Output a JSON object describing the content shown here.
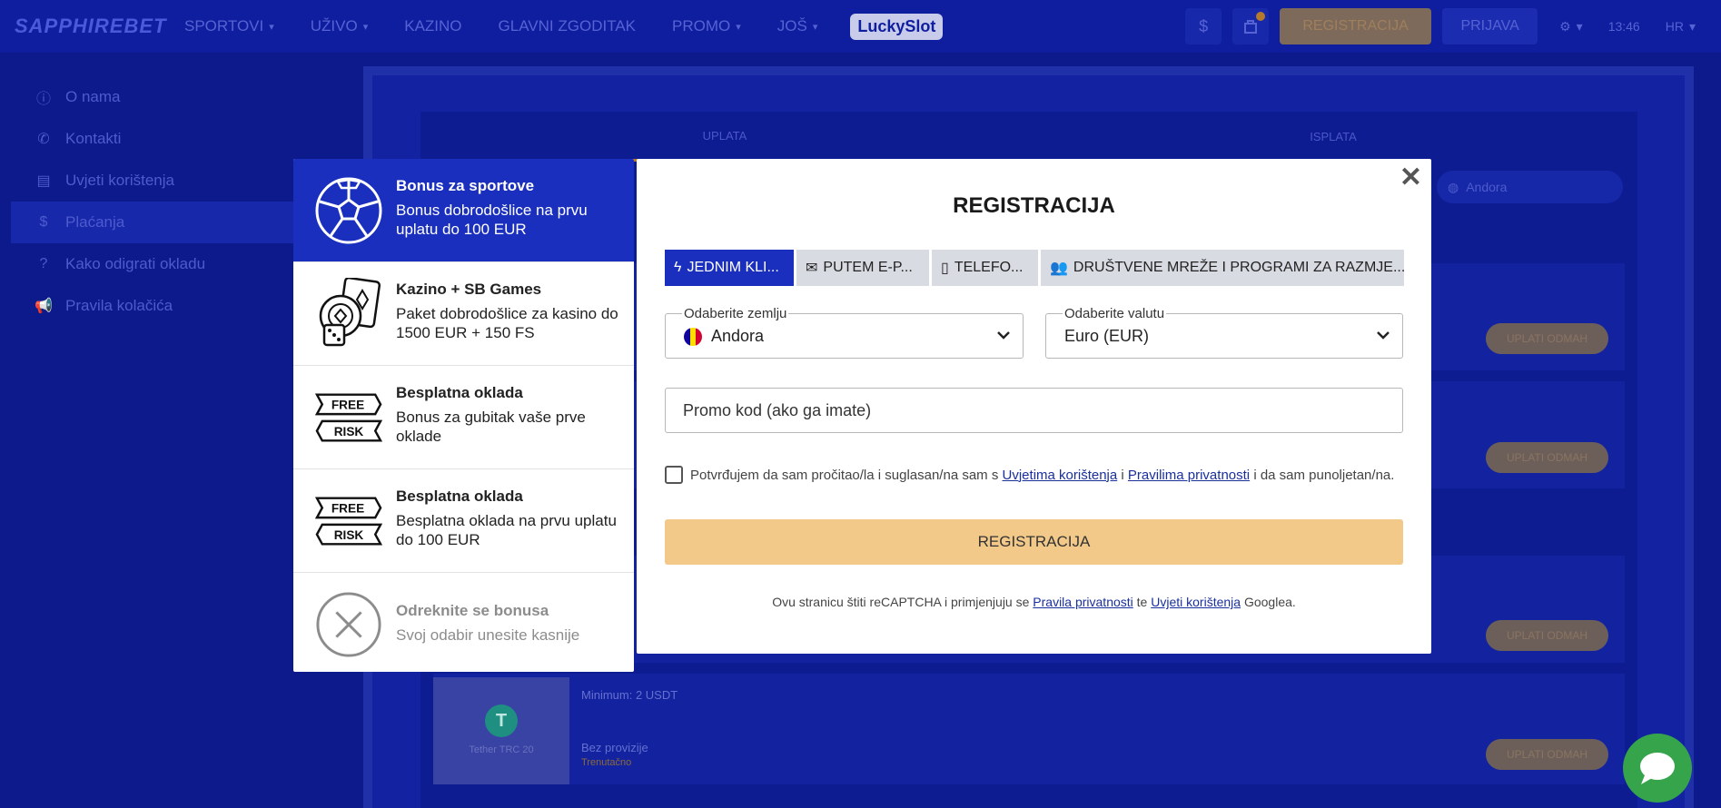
{
  "topbar": {
    "logo": "SAPPHIREBET",
    "nav": [
      {
        "label": "SPORTOVI",
        "chevron": true
      },
      {
        "label": "UŽIVO",
        "chevron": true
      },
      {
        "label": "KAZINO",
        "chevron": false
      },
      {
        "label": "GLAVNI ZGODITAK",
        "chevron": false
      },
      {
        "label": "PROMO",
        "chevron": true
      },
      {
        "label": "JOŠ",
        "chevron": true
      }
    ],
    "lucky": "LuckySlot",
    "register_label": "REGISTRACIJA",
    "login_label": "PRIJAVA",
    "time": "13:46",
    "language": "HR",
    "dollar_icon": "$"
  },
  "sidebar": {
    "items": [
      {
        "label": "O nama",
        "icon": "info-icon"
      },
      {
        "label": "Kontakti",
        "icon": "phone-icon"
      },
      {
        "label": "Uvjeti korištenja",
        "icon": "document-icon"
      },
      {
        "label": "Plaćanja",
        "icon": "dollar-icon"
      },
      {
        "label": "Kako odigrati okladu",
        "icon": "question-icon"
      },
      {
        "label": "Pravila kolačića",
        "icon": "megaphone-icon"
      }
    ]
  },
  "background": {
    "tab_deposit": "UPLATA",
    "tab_withdraw": "ISPLATA",
    "country": "Andora",
    "deposit_button": "UPLATI ODMAH",
    "tether_label": "Tether TRC 20",
    "minimum": "Minimum: 2 USDT",
    "no_commission": "Bez provizije",
    "instant": "Trenutačno"
  },
  "bonuses": [
    {
      "title": "Bonus za sportove",
      "desc": "Bonus dobrodošlice na prvu uplatu do 100 EUR",
      "icon": "soccer-ball-icon",
      "active": true
    },
    {
      "title": "Kazino + SB Games",
      "desc": "Paket dobrodošlice za kasino do 1500 EUR + 150 FS",
      "icon": "casino-chips-icon",
      "active": false
    },
    {
      "title": "Besplatna oklada",
      "desc": "Bonus za gubitak vaše prve oklade",
      "icon": "free-risk-icon",
      "active": false
    },
    {
      "title": "Besplatna oklada",
      "desc": "Besplatna oklada na prvu uplatu do 100 EUR",
      "icon": "free-risk-icon",
      "active": false
    },
    {
      "title": "Odreknite se bonusa",
      "desc": "Svoj odabir unesite kasnije",
      "icon": "decline-icon",
      "active": false
    }
  ],
  "free_risk": {
    "top": "FREE",
    "bottom": "RISK"
  },
  "modal": {
    "title": "REGISTRACIJA",
    "tabs": [
      {
        "label": "JEDNIM KLI...",
        "icon": "lightning-icon"
      },
      {
        "label": "PUTEM E-P...",
        "icon": "envelope-icon"
      },
      {
        "label": "TELEFO...",
        "icon": "phone-icon"
      },
      {
        "label": "DRUŠTVENE MREŽE I PROGRAMI ZA RAZMJE...",
        "icon": "people-icon"
      }
    ],
    "country_label": "Odaberite zemlju",
    "country_value": "Andora",
    "currency_label": "Odaberite valutu",
    "currency_value": "Euro (EUR)",
    "promo_placeholder": "Promo kod (ako ga imate)",
    "terms_prefix": "Potvrđujem da sam pročitao/la i suglasan/na sam s",
    "terms_link1": "Uvjetima korištenja",
    "terms_mid": "i",
    "terms_link2": "Pravilima privatnosti",
    "terms_suffix": "i da sam punoljetan/na.",
    "register_button": "REGISTRACIJA",
    "recaptcha_prefix": "Ovu stranicu štiti reCAPTCHA i primjenjuju se",
    "recaptcha_link1": "Pravila privatnosti",
    "recaptcha_mid": "te",
    "recaptcha_link2": "Uvjeti korištenja",
    "recaptcha_suffix": "Googlea.",
    "close_symbol": "✕"
  },
  "colors": {
    "accent": "#1a2fbe",
    "register_button": "#f3c98a",
    "chat": "#35a44a"
  }
}
